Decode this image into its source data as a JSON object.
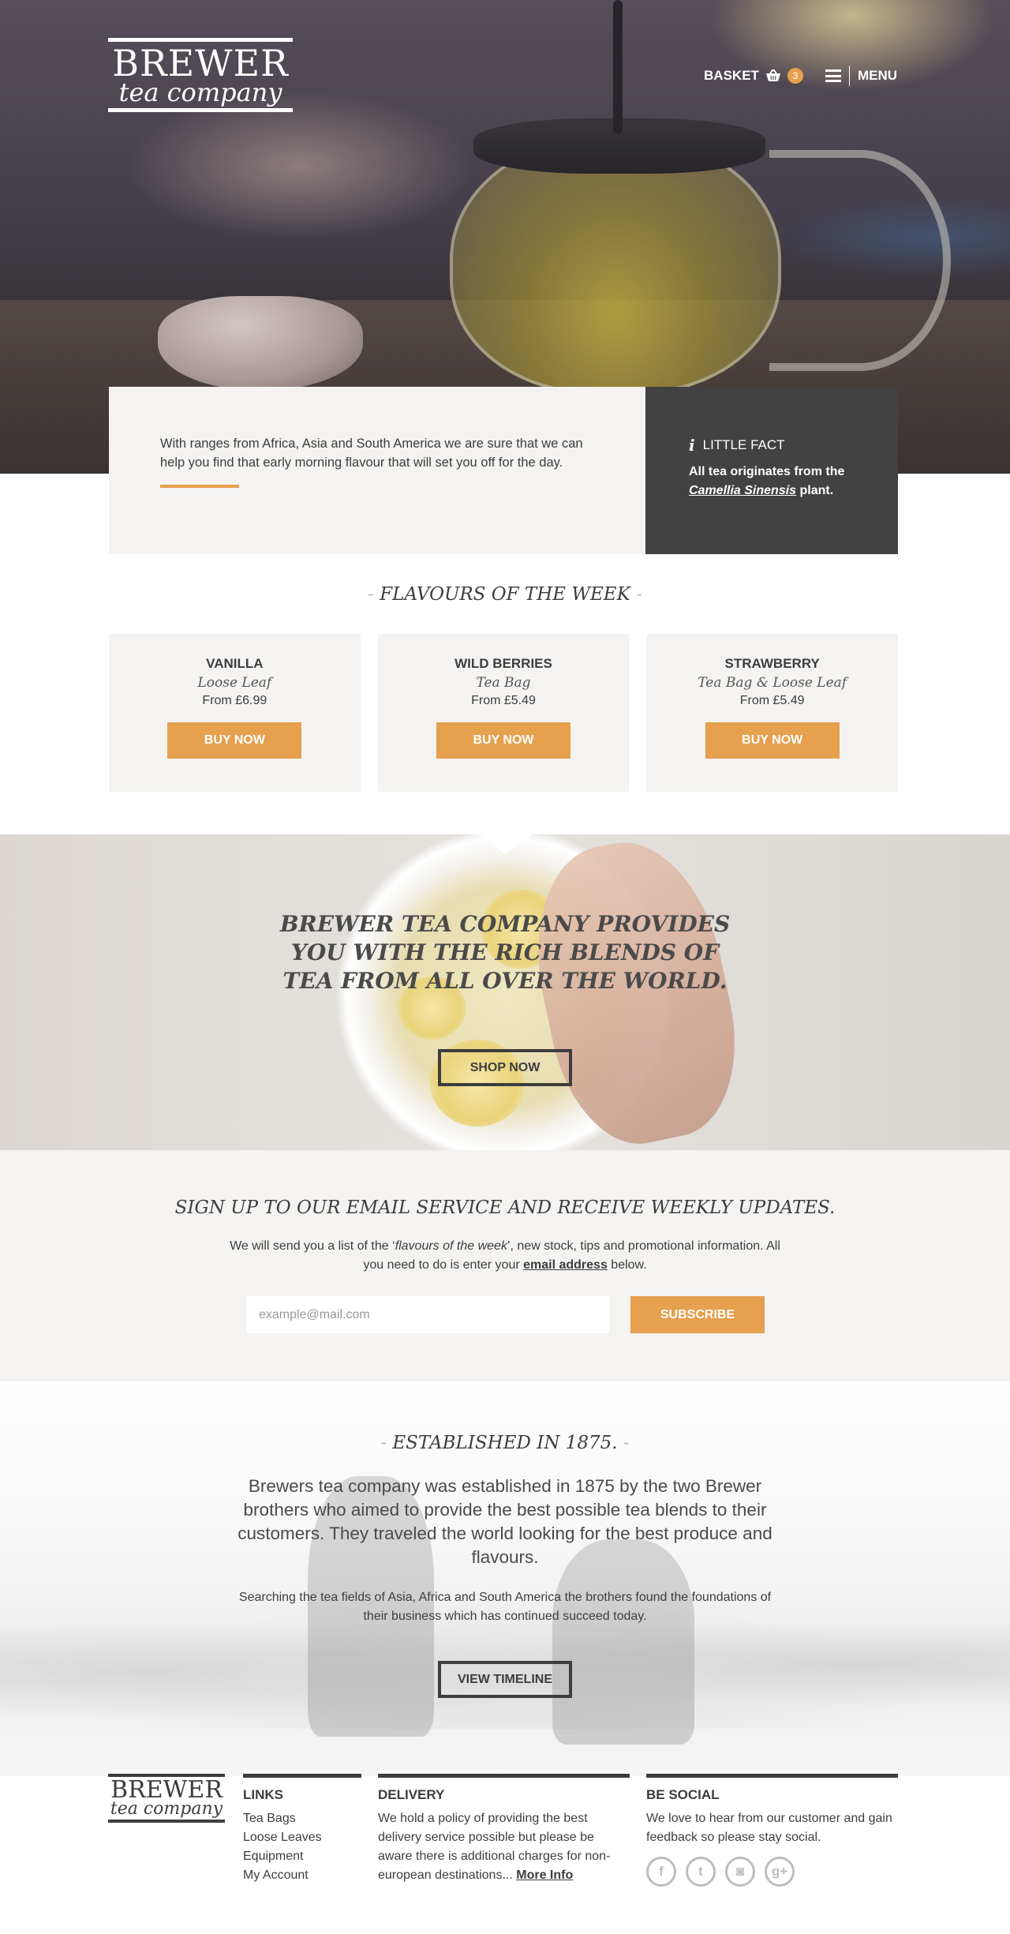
{
  "brand": {
    "line1": "BREWER",
    "line2": "tea company"
  },
  "nav": {
    "basket_label": "BASKET",
    "basket_count": "3",
    "menu_label": "MENU"
  },
  "intro": {
    "text": "With ranges from Africa, Asia and South America we are sure that we can help you find that early morning flavour that will set you off for the day."
  },
  "fact": {
    "icon": "i",
    "title": "LITTLE FACT",
    "text_before": "All tea originates from the",
    "highlight": "Camellia Sinensis",
    "text_after": "plant."
  },
  "flavours": {
    "title": "FLAVOURS OF THE WEEK",
    "items": [
      {
        "name": "VANILLA",
        "type": "Loose Leaf",
        "price": "From £6.99",
        "button": "BUY NOW"
      },
      {
        "name": "WILD BERRIES",
        "type": "Tea Bag",
        "price": "From £5.49",
        "button": "BUY NOW"
      },
      {
        "name": "STRAWBERRY",
        "type": "Tea Bag & Loose Leaf",
        "price": "From £5.49",
        "button": "BUY NOW"
      }
    ]
  },
  "banner": {
    "headline": "BREWER TEA COMPANY PROVIDES YOU WITH THE RICH BLENDS OF TEA FROM ALL OVER THE WORLD.",
    "button": "SHOP NOW"
  },
  "signup": {
    "title": "SIGN UP TO OUR EMAIL SERVICE AND RECEIVE WEEKLY UPDATES.",
    "desc_1": "We will send you a list of the ‘",
    "desc_em": "flavours of the week",
    "desc_2": "’, new stock, tips and promotional information. All you need to do is enter your ",
    "desc_bold": "email address",
    "desc_3": " below.",
    "placeholder": "example@mail.com",
    "button": "SUBSCRIBE"
  },
  "established": {
    "title": "ESTABLISHED IN 1875.",
    "lead": "Brewers tea company was established in 1875 by the two Brewer brothers who aimed to provide the best possible tea blends to their customers. They traveled the world looking for the best produce and flavours.",
    "small": "Searching the tea fields of Asia, Africa and South America the brothers found the foundations of their business which has continued succeed today.",
    "button": "VIEW TIMELINE"
  },
  "footer": {
    "links": {
      "title": "LINKS",
      "items": [
        "Tea Bags",
        "Loose Leaves",
        "Equipment",
        "My Account"
      ]
    },
    "delivery": {
      "title": "DELIVERY",
      "text": "We hold a policy of providing the best delivery service possible but please be aware there is additional charges for non-european destinations...",
      "more": "More Info"
    },
    "social": {
      "title": "BE SOCIAL",
      "text": "We love to hear from our customer and gain feedback so please stay social.",
      "icons": [
        "f",
        "t",
        "◙",
        "g+"
      ]
    }
  },
  "colors": {
    "accent": "#e6a04e",
    "dark": "#424243",
    "panel": "#f4f3f1"
  }
}
